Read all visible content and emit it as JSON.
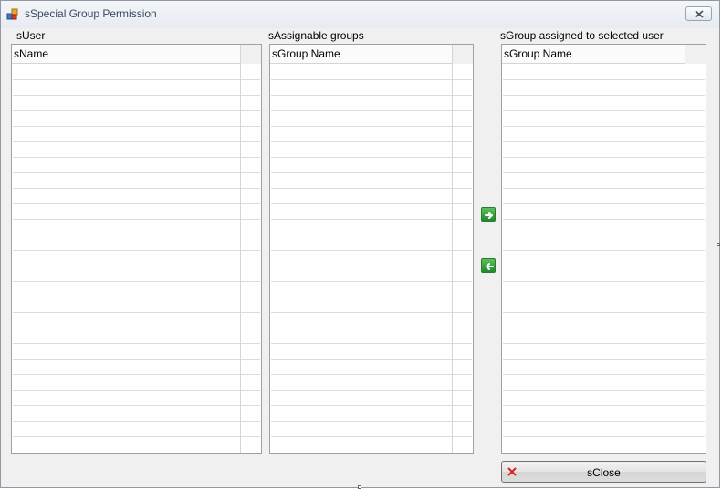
{
  "window": {
    "title": "sSpecial Group Permission"
  },
  "panels": {
    "user": {
      "label": "sUser",
      "column_header": "sName",
      "rows": []
    },
    "assignable": {
      "label": "sAssignable groups",
      "column_header": "sGroup Name",
      "rows": []
    },
    "assigned": {
      "label": "sGroup assigned to selected user",
      "column_header": "sGroup Name",
      "rows": []
    }
  },
  "buttons": {
    "close_label": "sClose"
  },
  "icons": {
    "app": "window-app-icon",
    "window_close": "close-icon",
    "add": "arrow-right-icon",
    "remove": "arrow-left-icon",
    "close": "red-x-icon"
  },
  "colors": {
    "arrow_green": "#2e9a36",
    "close_red": "#d9241b"
  }
}
